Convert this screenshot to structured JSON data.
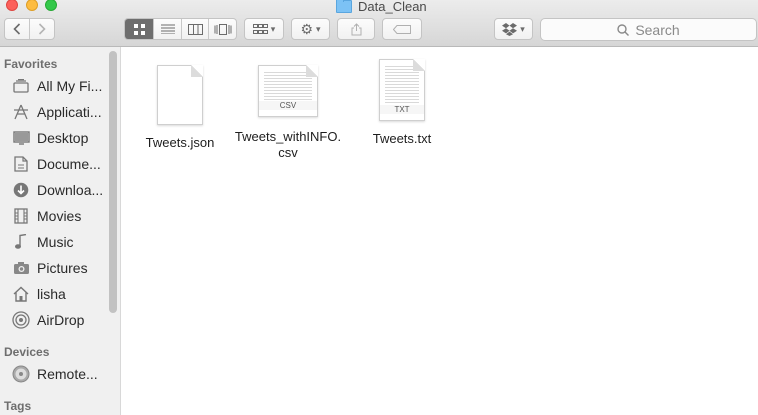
{
  "window": {
    "title": "Data_Clean"
  },
  "toolbar": {
    "search_placeholder": "Search",
    "view_modes": [
      "icon-view",
      "list-view",
      "column-view",
      "cover-flow-view"
    ],
    "active_view": "icon-view"
  },
  "sidebar": {
    "favorites_header": "Favorites",
    "favorites": [
      {
        "label": "All My Fi...",
        "icon": "all-files-icon"
      },
      {
        "label": "Applicati...",
        "icon": "applications-icon"
      },
      {
        "label": "Desktop",
        "icon": "desktop-icon"
      },
      {
        "label": "Docume...",
        "icon": "documents-icon"
      },
      {
        "label": "Downloa...",
        "icon": "downloads-icon"
      },
      {
        "label": "Movies",
        "icon": "movies-icon"
      },
      {
        "label": "Music",
        "icon": "music-icon"
      },
      {
        "label": "Pictures",
        "icon": "pictures-icon"
      },
      {
        "label": "lisha",
        "icon": "home-icon"
      },
      {
        "label": "AirDrop",
        "icon": "airdrop-icon"
      }
    ],
    "devices_header": "Devices",
    "devices": [
      {
        "label": "Remote...",
        "icon": "remote-disc-icon"
      }
    ],
    "tags_header": "Tags"
  },
  "files": [
    {
      "name": "Tweets.json",
      "badge": ""
    },
    {
      "name_line1": "Tweets_withINFO.",
      "name_line2": "csv",
      "badge": "CSV"
    },
    {
      "name": "Tweets.txt",
      "badge": "TXT"
    }
  ],
  "colors": {
    "close": "#fc605b",
    "minimize": "#fdbc40",
    "zoom": "#34c84a",
    "folder": "#7cc2f5"
  }
}
